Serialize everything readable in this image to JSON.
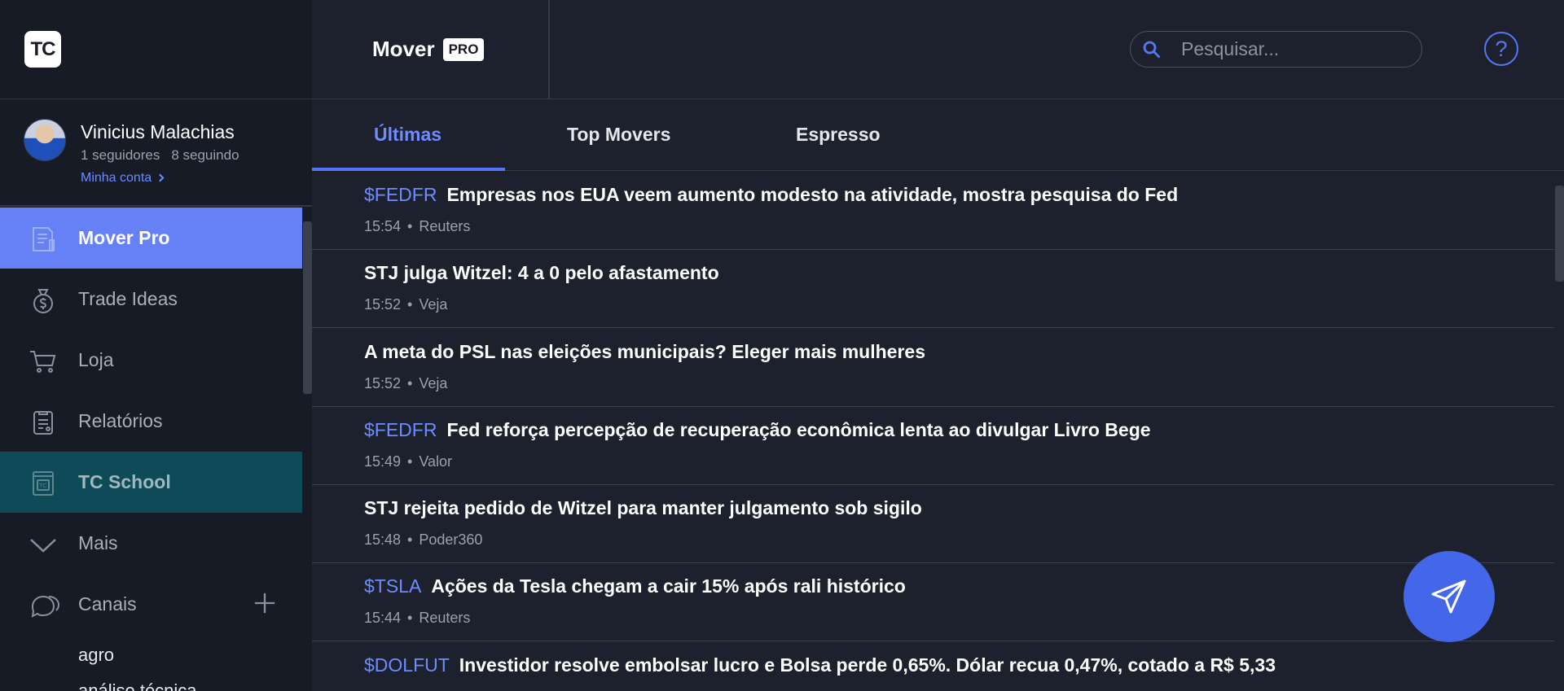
{
  "app": {
    "logo_text": "TC"
  },
  "profile": {
    "name": "Vinicius Malachias",
    "followers": "1 seguidores",
    "following": "8 seguindo",
    "account_link": "Minha conta"
  },
  "sidebar": {
    "items": [
      {
        "label": "Mover Pro",
        "icon": "document-icon"
      },
      {
        "label": "Trade Ideas",
        "icon": "money-bag-icon"
      },
      {
        "label": "Loja",
        "icon": "cart-icon"
      },
      {
        "label": "Relatórios",
        "icon": "report-icon"
      },
      {
        "label": "TC School",
        "icon": "school-icon"
      },
      {
        "label": "Mais",
        "icon": "chevron-down-icon"
      }
    ],
    "channels_label": "Canais",
    "channels": [
      "agro",
      "análise técnica"
    ]
  },
  "header": {
    "title": "Mover",
    "badge": "PRO",
    "search_placeholder": "Pesquisar...",
    "help": "?"
  },
  "tabs": [
    "Últimas",
    "Top Movers",
    "Espresso"
  ],
  "feed": [
    {
      "ticker": "$FEDFR",
      "headline": "Empresas nos EUA veem aumento modesto na atividade, mostra pesquisa do Fed",
      "time": "15:54",
      "source": "Reuters"
    },
    {
      "ticker": "",
      "headline": "STJ julga Witzel: 4 a 0 pelo afastamento",
      "time": "15:52",
      "source": "Veja"
    },
    {
      "ticker": "",
      "headline": "A meta do PSL nas eleições municipais? Eleger mais mulheres",
      "time": "15:52",
      "source": "Veja"
    },
    {
      "ticker": "$FEDFR",
      "headline": "Fed reforça percepção de recuperação econômica lenta ao divulgar Livro Bege",
      "time": "15:49",
      "source": "Valor"
    },
    {
      "ticker": "",
      "headline": "STJ rejeita pedido de Witzel para manter julgamento sob sigilo",
      "time": "15:48",
      "source": "Poder360"
    },
    {
      "ticker": "$TSLA",
      "headline": "Ações da Tesla chegam a cair 15% após rali histórico",
      "time": "15:44",
      "source": "Reuters"
    },
    {
      "ticker": "$DOLFUT",
      "headline": "Investidor resolve embolsar lucro e Bolsa perde 0,65%. Dólar recua 0,47%, cotado a R$ 5,33",
      "time": "",
      "source": ""
    }
  ],
  "colors": {
    "accent": "#5676f3",
    "active_nav": "#6680f5",
    "school_nav": "#0e4a57",
    "background": "#1c212d",
    "sidebar": "#161b25"
  }
}
